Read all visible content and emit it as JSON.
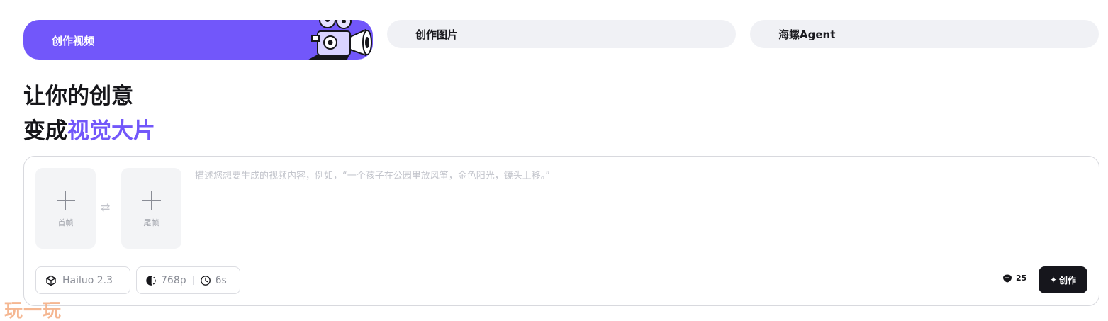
{
  "tabs": [
    {
      "label": "创作视频",
      "active": true
    },
    {
      "label": "创作图片",
      "active": false
    },
    {
      "label": "海螺Agent",
      "active": false
    }
  ],
  "headline": {
    "line1": "让你的创意",
    "line2_prefix": "变成",
    "line2_accent": "视觉大片"
  },
  "composer": {
    "first_frame_label": "首帧",
    "last_frame_label": "尾帧",
    "swap_icon": "⇄",
    "prompt_placeholder": "描述您想要生成的视频内容，例如，“一个孩子在公园里放风筝，金色阳光，镜头上移。”",
    "model_label": "Hailuo 2.3",
    "resolution_label": "768p",
    "duration_label": "6s",
    "credits": "25",
    "create_label": "创作",
    "create_icon": "✦"
  },
  "watermark": "玩一玩",
  "colors": {
    "accent": "#7257fa",
    "tab_bg": "#f0f1f5",
    "button_dark": "#16161c"
  }
}
